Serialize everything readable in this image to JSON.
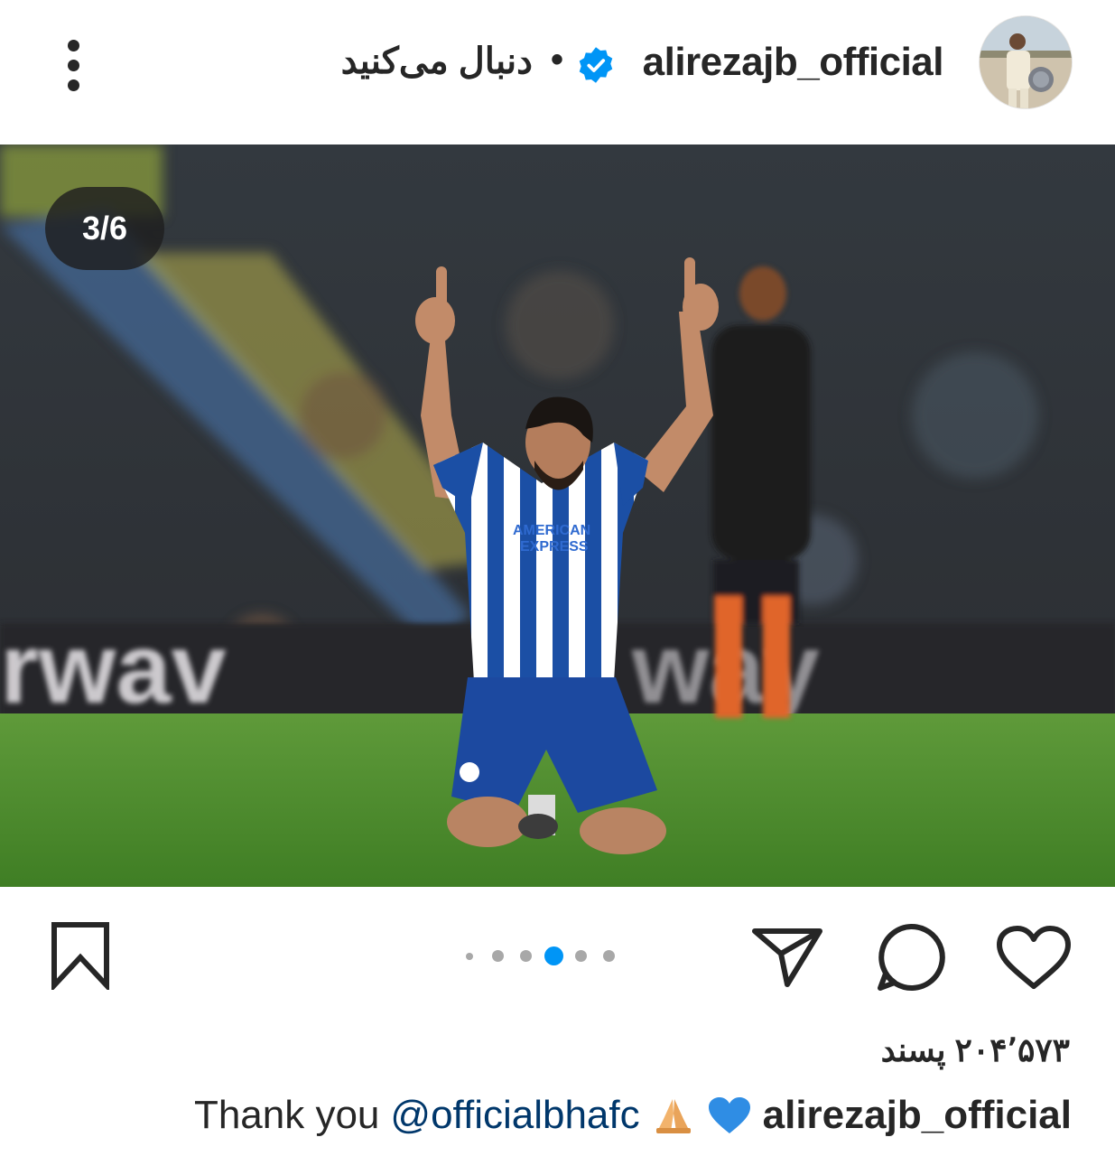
{
  "header": {
    "username": "alirezajb_official",
    "follow_status": "دنبال می‌کنید",
    "separator": "•",
    "avatar_icon": "user-avatar-icon",
    "verified_icon": "verified-badge-icon",
    "more_icon": "more-vertical-icon"
  },
  "media": {
    "counter": "3/6",
    "current_index": 3,
    "total": 6
  },
  "actions": {
    "save_icon": "bookmark-icon",
    "share_icon": "send-icon",
    "comment_icon": "comment-icon",
    "like_icon": "heart-icon"
  },
  "likes": {
    "count": "۲۰۴٬۵۷۳",
    "label": "پسند"
  },
  "caption": {
    "username": "alirezajb_official",
    "text_prefix": "Thank you",
    "mention": "@officialbhafc",
    "emojis": [
      "praying-hands-icon",
      "blue-heart-icon"
    ]
  },
  "colors": {
    "text": "#262626",
    "verified": "#0095f6",
    "active_dot": "#0095f6",
    "inactive_dot": "#a8a8a8",
    "mention": "#00376b"
  }
}
